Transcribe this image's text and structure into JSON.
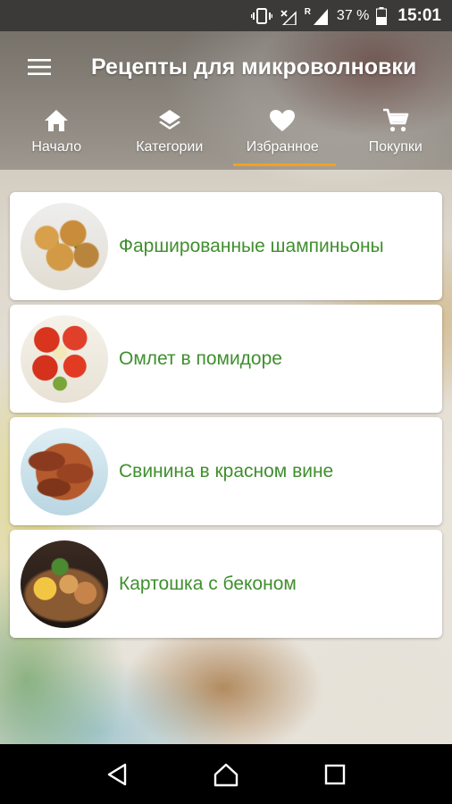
{
  "status_bar": {
    "battery_percent": "37 %",
    "time": "15:01",
    "signal_roaming_mark": "R",
    "icons": [
      "vibrate-icon",
      "no-signal-icon",
      "signal-icon",
      "battery-icon"
    ]
  },
  "app": {
    "title": "Рецепты для микроволновки"
  },
  "tabs": [
    {
      "label": "Начало",
      "icon": "home-icon",
      "active": false
    },
    {
      "label": "Категории",
      "icon": "layers-icon",
      "active": false
    },
    {
      "label": "Избранное",
      "icon": "heart-icon",
      "active": true
    },
    {
      "label": "Покупки",
      "icon": "cart-icon",
      "active": false
    }
  ],
  "recipes": [
    {
      "title": "Фаршированные шампиньоны"
    },
    {
      "title": "Омлет в помидоре"
    },
    {
      "title": "Свинина в красном вине"
    },
    {
      "title": "Картошка с беконом"
    }
  ],
  "colors": {
    "accent": "#f3a21c",
    "recipe_title": "#3f8f2e",
    "status_bar": "#3b3a38",
    "nav_bar": "#000000"
  }
}
